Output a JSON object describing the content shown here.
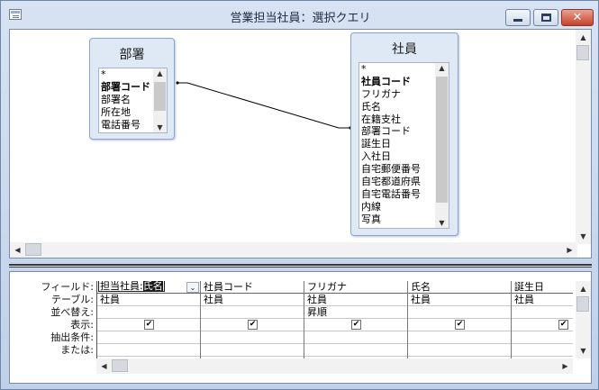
{
  "window": {
    "title": "営業担当社員：選択クエリ",
    "minimize_icon": "minimize-icon",
    "maximize_icon": "maximize-icon",
    "close_icon": "close-icon",
    "close_glyph": "✕"
  },
  "tables": [
    {
      "name": "部署",
      "fields": [
        "*",
        "部署コード",
        "部署名",
        "所在地",
        "電話番号"
      ],
      "primary_key": "部署コード"
    },
    {
      "name": "社員",
      "fields": [
        "*",
        "社員コード",
        "フリガナ",
        "氏名",
        "在籍支社",
        "部署コード",
        "誕生日",
        "入社日",
        "自宅郵便番号",
        "自宅都道府県",
        "自宅電話番号",
        "内線",
        "写真"
      ],
      "primary_key": "社員コード"
    }
  ],
  "grid": {
    "row_labels": [
      "フィールド:",
      "テーブル:",
      "並べ替え:",
      "表示:",
      "抽出条件:",
      "または:"
    ],
    "columns": [
      {
        "field": "担当社員: 氏名",
        "field_prefix": "担当社員:",
        "field_highlight": "氏名",
        "table": "社員",
        "sort": "",
        "show": true
      },
      {
        "field": "社員コード",
        "table": "社員",
        "sort": "",
        "show": true
      },
      {
        "field": "フリガナ",
        "table": "社員",
        "sort": "昇順",
        "show": true
      },
      {
        "field": "氏名",
        "table": "社員",
        "sort": "",
        "show": true
      },
      {
        "field": "誕生日",
        "table": "社員",
        "sort": "",
        "show": true
      }
    ],
    "check_glyph": "✔",
    "dropdown_glyph": "⌄"
  },
  "scroll_glyphs": {
    "up": "▲",
    "down": "▼",
    "left": "◀",
    "right": "▶"
  }
}
